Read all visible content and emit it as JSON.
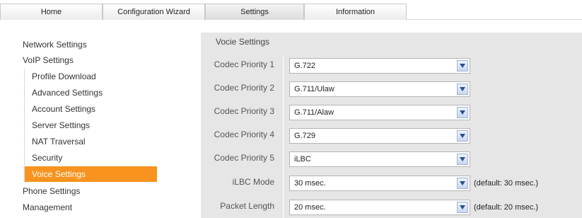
{
  "tabs": [
    {
      "label": "Home"
    },
    {
      "label": "Configuration Wizard"
    },
    {
      "label": "Settings"
    },
    {
      "label": "Information"
    }
  ],
  "sidebar": {
    "items": [
      {
        "label": "Network Settings"
      },
      {
        "label": "VoIP Settings"
      },
      {
        "label": "Profile Download"
      },
      {
        "label": "Advanced Settings"
      },
      {
        "label": "Account Settings"
      },
      {
        "label": "Server Settings"
      },
      {
        "label": "NAT Traversal"
      },
      {
        "label": "Security"
      },
      {
        "label": "Voice Settings"
      },
      {
        "label": "Phone Settings"
      },
      {
        "label": "Management"
      }
    ]
  },
  "main": {
    "section_title": "Vocie Settings",
    "rows": [
      {
        "label": "Codec Priority 1",
        "value": "G.722"
      },
      {
        "label": "Codec Priority 2",
        "value": "G.711/Ulaw"
      },
      {
        "label": "Codec Priority 3",
        "value": "G.711/Alaw"
      },
      {
        "label": "Codec Priority 4",
        "value": "G.729"
      },
      {
        "label": "Codec Priority 5",
        "value": "iLBC"
      },
      {
        "label": "iLBC Mode",
        "value": "30 msec.",
        "note": "(default: 30 msec.)"
      },
      {
        "label": "Packet Length",
        "value": "20 msec.",
        "note": "(default: 20 msec.)"
      }
    ]
  },
  "colors": {
    "active_sidebar": "#f7931e",
    "panel_bg": "#e6e6e6"
  }
}
